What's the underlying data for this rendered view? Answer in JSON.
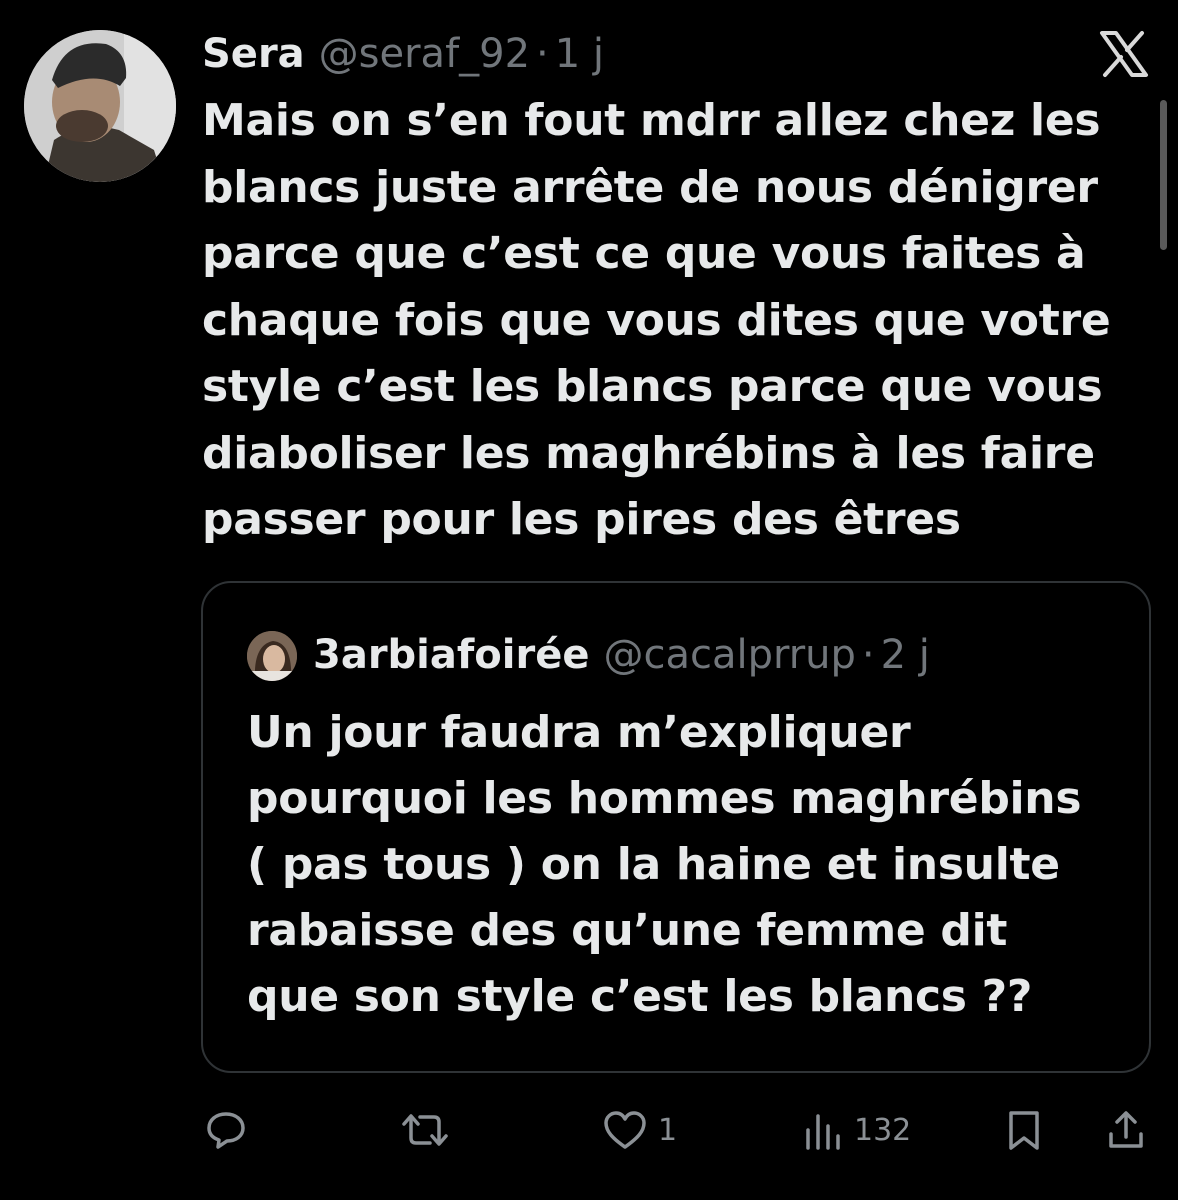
{
  "tweet": {
    "author_name": "Sera",
    "author_handle": "@seraf_92",
    "separator": "·",
    "time": "1 j",
    "text_lines": [
      "Mais on s’en fout mdrr allez chez les",
      "blancs juste arrête de nous dénigrer",
      "parce que c’est ce que vous faites à",
      "chaque fois que vous dites que votre",
      "style c’est les blancs parce que vous",
      "diaboliser les maghrébins à les faire",
      "passer pour les pires des êtres"
    ]
  },
  "quoted_tweet": {
    "author_name": "3arbiafoirée",
    "author_handle": "@cacalprrup",
    "separator": "·",
    "time": "2 j",
    "text_lines": [
      "Un jour faudra m’expliquer",
      "pourquoi les hommes maghrébins",
      "( pas tous ) on la haine et insulte",
      "rabaisse des qu’une femme dit",
      "que son style c’est les blancs ??"
    ]
  },
  "actions": {
    "reply_icon": "reply-icon",
    "retweet_icon": "retweet-icon",
    "like_icon": "heart-icon",
    "like_count": "1",
    "views_icon": "views-icon",
    "views_count": "132",
    "bookmark_icon": "bookmark-icon",
    "share_icon": "share-icon"
  },
  "brand_icon": "x-logo-icon",
  "colors": {
    "background": "#000000",
    "text_primary": "#e7e9ea",
    "text_secondary": "#71767b",
    "border": "#2f3336"
  }
}
